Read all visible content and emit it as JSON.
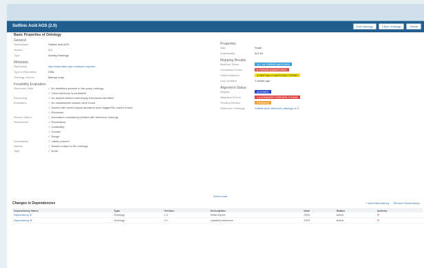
{
  "header": {
    "title": "Sulfinic Acid AGS (2.0)",
    "buttons": [
      "Edit Ontology",
      "Clone Ontology",
      "Delete"
    ]
  },
  "left": {
    "heading": "Basic Properties of Ontology",
    "general": {
      "title": "General",
      "rows": [
        {
          "label": "Namespace",
          "value": "Sulfinic acid AGS"
        },
        {
          "label": "Version",
          "value": "2.0"
        },
        {
          "label": "Type",
          "value": "Activity Ontology"
        }
      ]
    },
    "metadata": {
      "title": "Metadata",
      "rows": [
        {
          "label": "Repository",
          "value": "http://www.fake-repo.example.org/onto"
        },
        {
          "label": "Type in Repository",
          "value": "OWL"
        },
        {
          "label": "Ontology Source",
          "value": "Manual entry"
        }
      ]
    },
    "feedback": {
      "title": "Feasibility Evaluation",
      "rows": [
        {
          "label": "Structured Data",
          "value": "✓ No identifiers present in the query ontology"
        },
        {
          "label": "",
          "value": "✓ Class hierarchy is consistent"
        },
        {
          "label": "Reasoning",
          "value": "✓ No disjoint classes with empty extensions identified"
        },
        {
          "label": "Evaluation",
          "value": "✓ No unsatisfiable classes were found"
        },
        {
          "label": "",
          "value": "✓ Axioms with mixed logical operators were flagged for expert review"
        },
        {
          "label": "",
          "value": "✓ Reviewed"
        },
        {
          "label": "Review Status",
          "value": "✓ Annotation consistency verified with reference ontology"
        },
        {
          "label": "Restrictions",
          "value": "✓ Restrictions"
        },
        {
          "label": "",
          "value": "✓ Cardinality"
        },
        {
          "label": "",
          "value": "✓ Domain"
        },
        {
          "label": "",
          "value": "✓ Range"
        },
        {
          "label": "Annotations",
          "value": "✓ Labels present"
        },
        {
          "label": "Names",
          "value": "✓ Names unique to the ontology"
        },
        {
          "label": "Tags",
          "value": "✓ None"
        }
      ]
    }
  },
  "right": {
    "properties": {
      "title": "Properties",
      "rows": [
        {
          "label": "Size",
          "value": "Small"
        },
        {
          "label": "Expressivity",
          "value": "ALCHI"
        }
      ]
    },
    "mapping": {
      "title": "Mapping Results",
      "rows": [
        {
          "label": "Matched Terms",
          "badge": "12 / 18 TERMS MATCHED",
          "color": "blue"
        },
        {
          "label": "Unmatched Terms",
          "badge": "6 TERMS UNMATCHED",
          "color": "red"
        },
        {
          "label": "Partial Matches",
          "badge": "3 PARTIALLY MATCHED TERMS",
          "color": "yellow"
        },
        {
          "label": "Last Updated",
          "value": "2 weeks ago"
        }
      ]
    },
    "alignment": {
      "title": "Alignment Status",
      "rows": [
        {
          "label": "Aligned",
          "badge": "ALIGNED",
          "color": "navy"
        },
        {
          "label": "Alignment Errors",
          "badge": "2 ALIGNMENT ERRORS FOUND",
          "color": "red2"
        },
        {
          "label": "Pending Review",
          "badge": "PENDING",
          "color": "orange"
        },
        {
          "label": "Reference Ontology",
          "value": "Sulfinic acid reference ontology v1.3"
        }
      ]
    }
  },
  "show_more": "Show more",
  "changes": {
    "heading": "Changes in Dependencies",
    "actions": [
      "+ Add Dependency",
      "Remove Dependency"
    ],
    "columns": [
      "Dependency Name",
      "Type",
      "Version",
      "Description",
      "Date",
      "Status",
      "Actions"
    ],
    "rows": [
      {
        "name": "Dependency A",
        "type": "Ontology",
        "version": "1.0",
        "description": "Initial import",
        "date": "2023",
        "status": "Active"
      },
      {
        "name": "Dependency B",
        "type": "Ontology",
        "version": "2.1",
        "description": "Updated reference",
        "date": "2023",
        "status": "Active"
      }
    ]
  }
}
